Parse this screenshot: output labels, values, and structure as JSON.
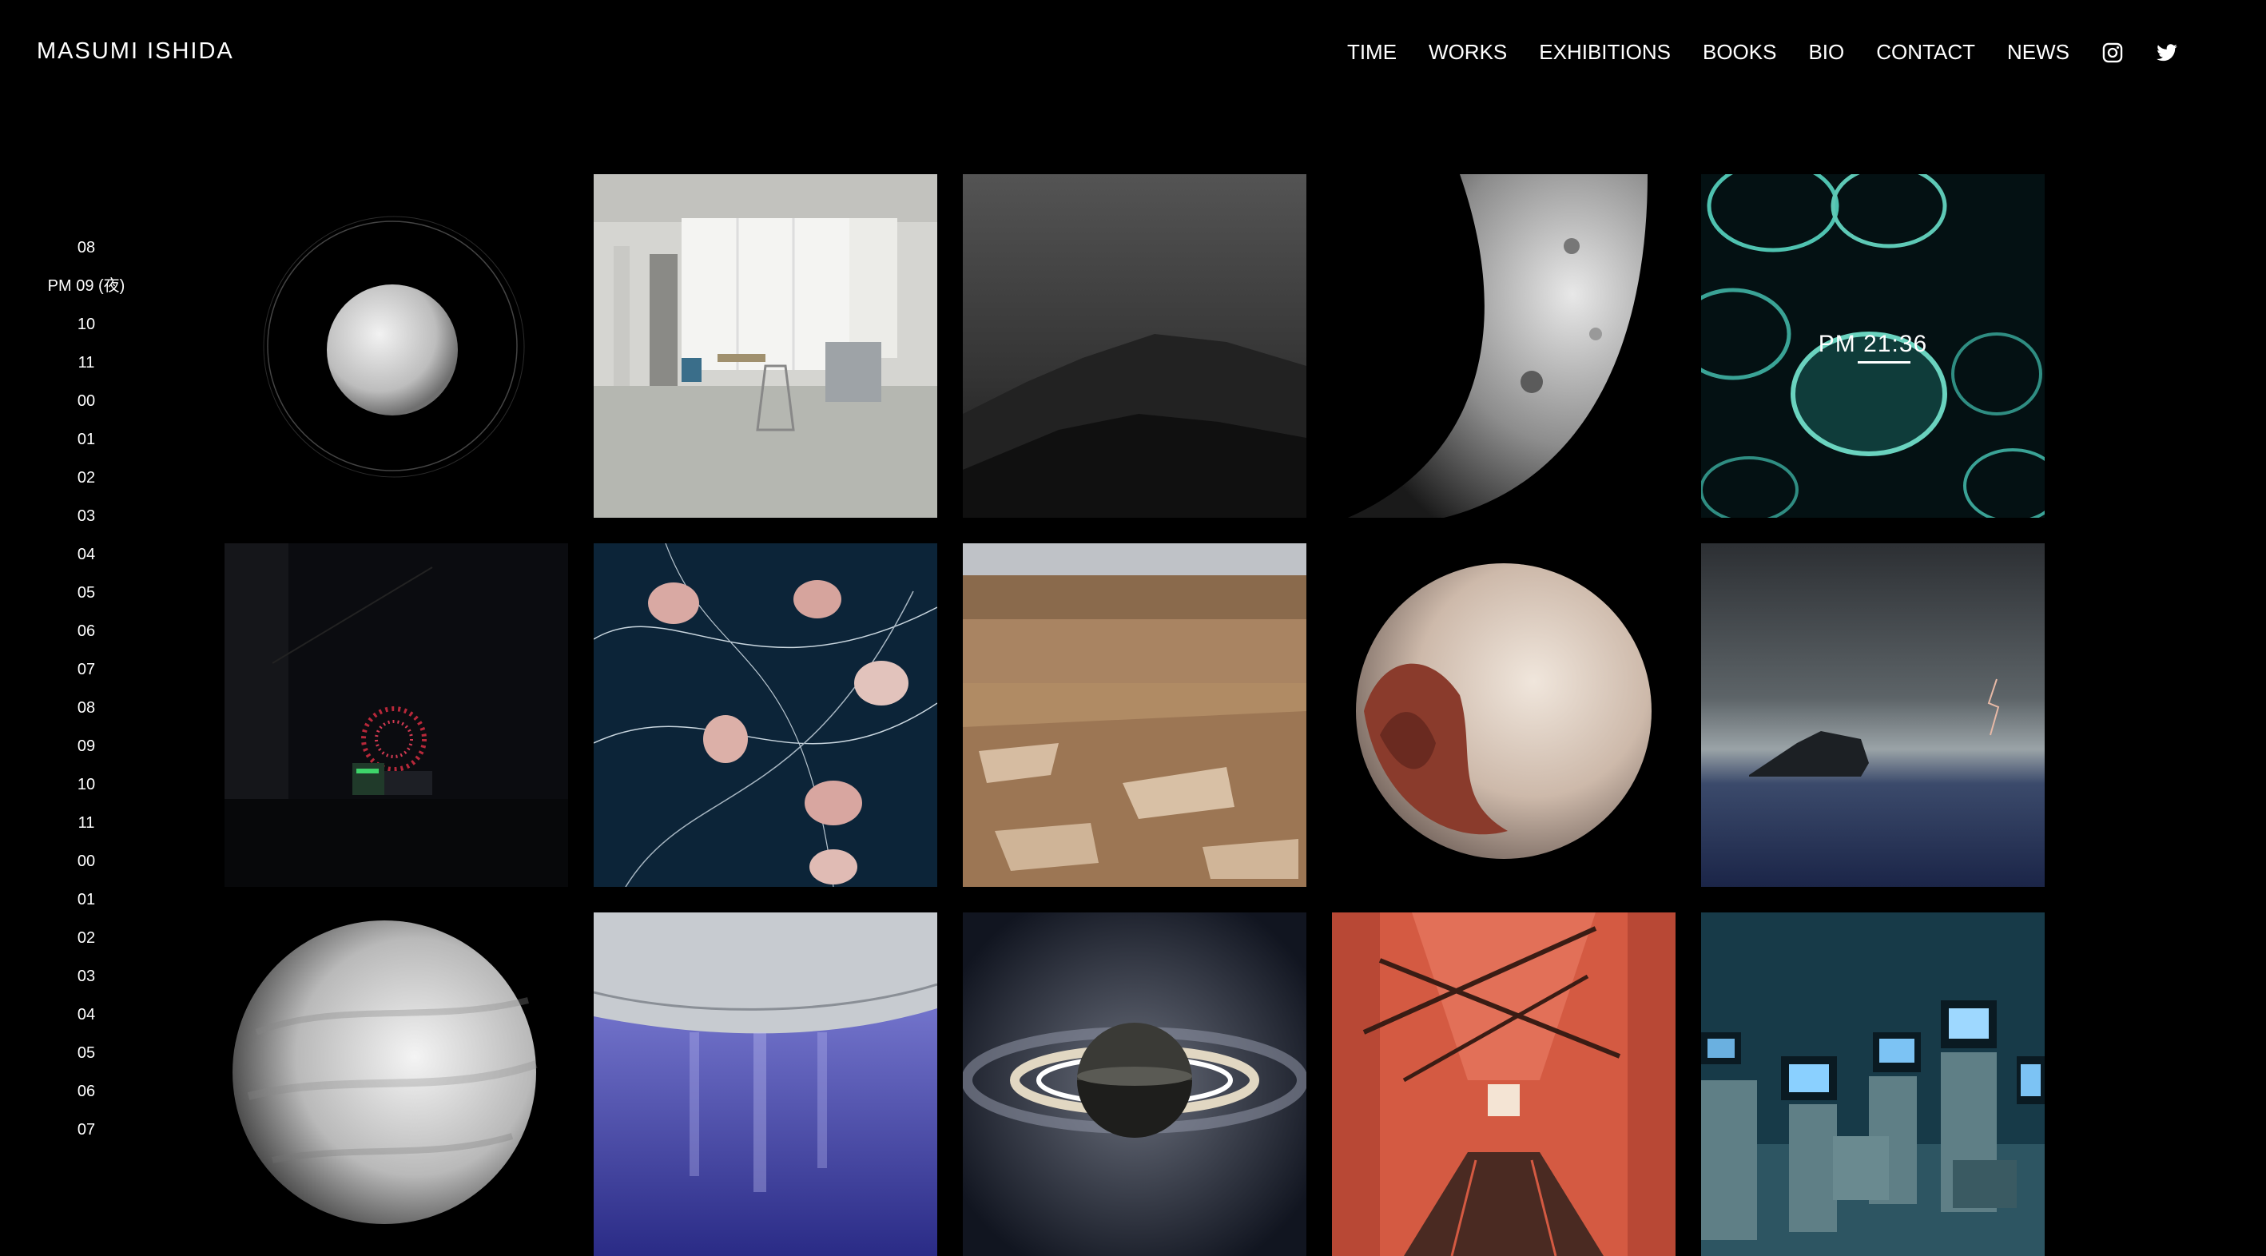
{
  "site": {
    "title": "MASUMI ISHIDA"
  },
  "nav": {
    "items": [
      {
        "label": "TIME"
      },
      {
        "label": "WORKS"
      },
      {
        "label": "EXHIBITIONS"
      },
      {
        "label": "BOOKS"
      },
      {
        "label": "BIO"
      },
      {
        "label": "CONTACT"
      },
      {
        "label": "NEWS"
      }
    ],
    "icons": [
      "instagram-icon",
      "twitter-icon"
    ]
  },
  "timeline": {
    "hours": [
      "08",
      "PM 09 (夜)",
      "10",
      "11",
      "00",
      "01",
      "02",
      "03",
      "04",
      "05",
      "06",
      "07",
      "08",
      "09",
      "10",
      "11",
      "00",
      "01",
      "02",
      "03",
      "04",
      "05",
      "06",
      "07"
    ]
  },
  "grid": {
    "hover_time": "PM 21:36",
    "tiles": [
      "planet-ring",
      "office-room",
      "foggy-mountain",
      "moon-crescent",
      "jellyfish-teal",
      "fireworks-night",
      "jellyfish-lines",
      "mars-landscape",
      "pluto",
      "stormy-sea",
      "venus",
      "icy-moon-plume",
      "saturn",
      "red-stairwell",
      "tv-room"
    ]
  },
  "colors": {
    "background": "#000000",
    "text": "#ffffff"
  }
}
